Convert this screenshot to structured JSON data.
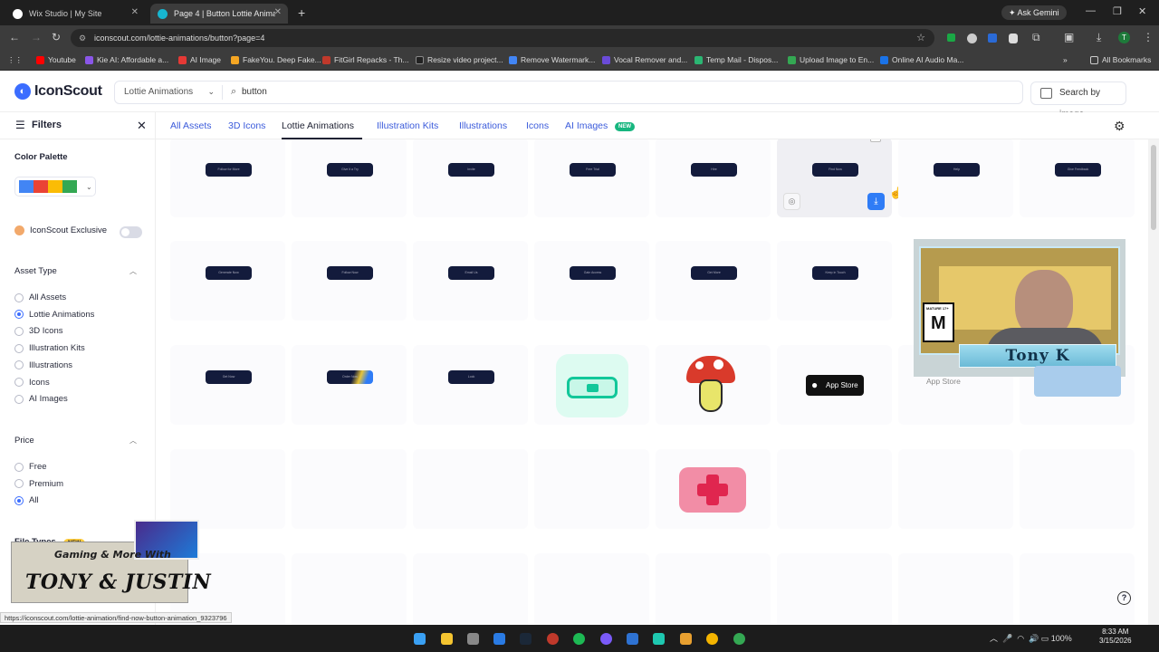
{
  "browser": {
    "tabs": [
      {
        "title": "Wix Studio | My Site",
        "color": "#ffffff"
      },
      {
        "title": "Page 4 | Button Lottie Animatio",
        "color": "#17b6d0"
      }
    ],
    "ask_gemini": "Ask Gemini",
    "url": "iconscout.com/lottie-animations/button?page=4",
    "bookmarks": [
      {
        "label": "Youtube",
        "color": "#ff0000"
      },
      {
        "label": "Kie AI: Affordable a...",
        "color": "#8a56e8"
      },
      {
        "label": "AI Image",
        "color": "#e53935"
      },
      {
        "label": "FakeYou. Deep Fake...",
        "color": "#f5a623"
      },
      {
        "label": "FitGirl Repacks - Th...",
        "color": "#c0392b"
      },
      {
        "label": "Resize video project...",
        "color": "#222222"
      },
      {
        "label": "Remove Watermark...",
        "color": "#4285f4"
      },
      {
        "label": "Vocal Remover and...",
        "color": "#6a4bd8"
      },
      {
        "label": "Temp Mail - Dispos...",
        "color": "#2bb673"
      },
      {
        "label": "Upload Image to En...",
        "color": "#34a853"
      },
      {
        "label": "Online AI Audio Ma...",
        "color": "#1a73e8"
      }
    ],
    "all_bookmarks": "All Bookmarks"
  },
  "header": {
    "logo": "IconScout",
    "asset_type": "Lottie Animations",
    "query": "button",
    "search_by_image": "Search by image"
  },
  "sidebar": {
    "title": "Filters",
    "color_palette": "Color Palette",
    "palette_colors": [
      "#4285f4",
      "#ea4335",
      "#fbbc05",
      "#34a853"
    ],
    "exclusive": "IconScout Exclusive",
    "asset_type_title": "Asset Type",
    "asset_types": [
      "All Assets",
      "Lottie Animations",
      "3D Icons",
      "Illustration Kits",
      "Illustrations",
      "Icons",
      "AI Images"
    ],
    "asset_type_selected": "Lottie Animations",
    "price_title": "Price",
    "prices": [
      "Free",
      "Premium",
      "All"
    ],
    "price_selected": "All",
    "file_types": "File Types",
    "file_types_badge": "NEW"
  },
  "content_tabs": {
    "items": [
      "All Assets",
      "3D Icons",
      "Lottie Animations",
      "Illustration Kits",
      "Illustrations",
      "Icons",
      "AI Images"
    ],
    "active": "Lottie Animations",
    "badge": "NEW"
  },
  "grid": {
    "row1": [
      "Follow for More",
      "Give it a Try",
      "Invite",
      "Free Trial",
      "Hire",
      "Find Now",
      "Help",
      "Give Feedback"
    ],
    "row2": [
      "Generate Now",
      "Follow Now",
      "Email Us",
      "Gain Access",
      "Get More",
      "Keep in Touch"
    ],
    "row3_pills": [
      "Get Now",
      "Order Now",
      "Lock"
    ],
    "row3_appstore": "App Store",
    "accent_blue": "#2f7cf6"
  },
  "overlays": {
    "webcam_name": "Tony K",
    "webcam_rating": "M",
    "webcam_rating_caption": "MATURE 17+",
    "appstore_under": "App Store",
    "banner_line1": "Gaming & More With",
    "banner_line2": "TONY & JUSTIN"
  },
  "status_url": "https://iconscout.com/lottie-animation/find-now-button-animation_9323796",
  "taskbar": {
    "battery": "100%",
    "time": "8:33 AM",
    "date": "3/15/2026"
  }
}
